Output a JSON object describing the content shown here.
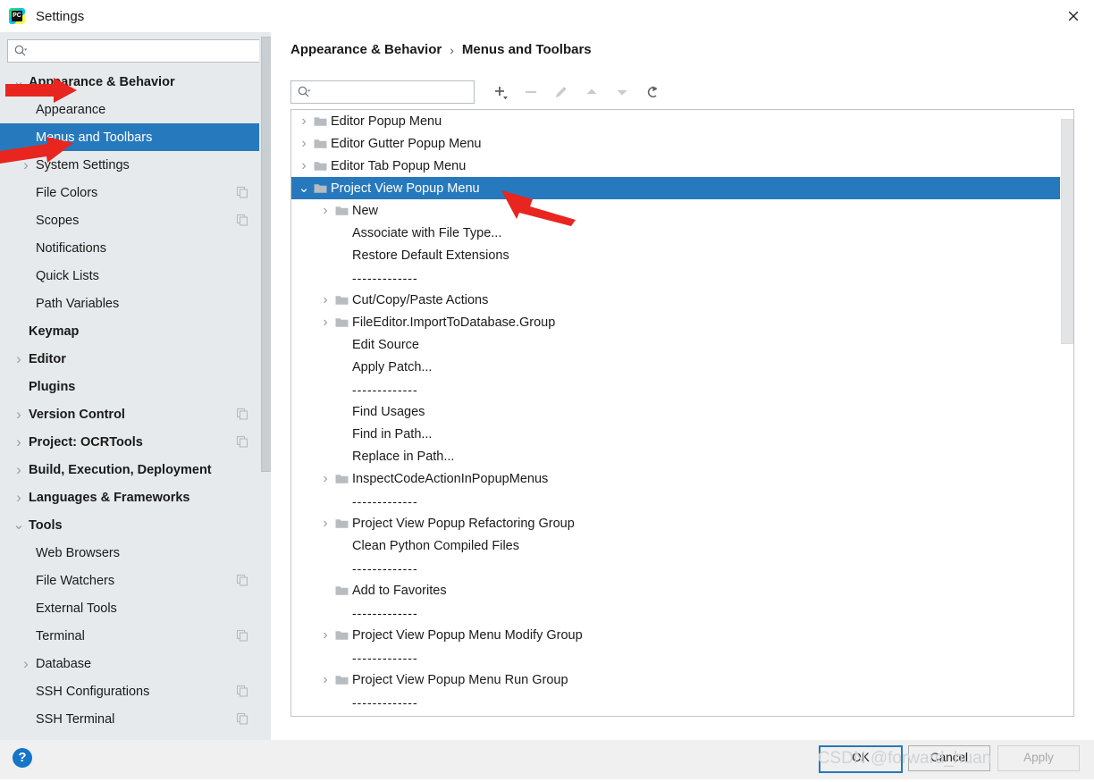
{
  "window": {
    "title": "Settings",
    "app_icon": "pycharm-icon",
    "close_icon": "close-icon"
  },
  "sidebar": {
    "search": {
      "placeholder": "",
      "value": "",
      "icon": "search-icon"
    },
    "items": [
      {
        "label": "Appearance & Behavior",
        "indent": 0,
        "bold": true,
        "arrow": "expanded",
        "badge": false,
        "selected": false
      },
      {
        "label": "Appearance",
        "indent": 1,
        "bold": false,
        "arrow": "none",
        "badge": false,
        "selected": false
      },
      {
        "label": "Menus and Toolbars",
        "indent": 1,
        "bold": false,
        "arrow": "none",
        "badge": false,
        "selected": true
      },
      {
        "label": "System Settings",
        "indent": 1,
        "bold": false,
        "arrow": "collapsed",
        "badge": false,
        "selected": false
      },
      {
        "label": "File Colors",
        "indent": 1,
        "bold": false,
        "arrow": "none",
        "badge": true,
        "selected": false
      },
      {
        "label": "Scopes",
        "indent": 1,
        "bold": false,
        "arrow": "none",
        "badge": true,
        "selected": false
      },
      {
        "label": "Notifications",
        "indent": 1,
        "bold": false,
        "arrow": "none",
        "badge": false,
        "selected": false
      },
      {
        "label": "Quick Lists",
        "indent": 1,
        "bold": false,
        "arrow": "none",
        "badge": false,
        "selected": false
      },
      {
        "label": "Path Variables",
        "indent": 1,
        "bold": false,
        "arrow": "none",
        "badge": false,
        "selected": false
      },
      {
        "label": "Keymap",
        "indent": 0,
        "bold": true,
        "arrow": "none",
        "badge": false,
        "selected": false
      },
      {
        "label": "Editor",
        "indent": 0,
        "bold": true,
        "arrow": "collapsed",
        "badge": false,
        "selected": false
      },
      {
        "label": "Plugins",
        "indent": 0,
        "bold": true,
        "arrow": "none",
        "badge": false,
        "selected": false
      },
      {
        "label": "Version Control",
        "indent": 0,
        "bold": true,
        "arrow": "collapsed",
        "badge": true,
        "selected": false
      },
      {
        "label": "Project: OCRTools",
        "indent": 0,
        "bold": true,
        "arrow": "collapsed",
        "badge": true,
        "selected": false
      },
      {
        "label": "Build, Execution, Deployment",
        "indent": 0,
        "bold": true,
        "arrow": "collapsed",
        "badge": false,
        "selected": false
      },
      {
        "label": "Languages & Frameworks",
        "indent": 0,
        "bold": true,
        "arrow": "collapsed",
        "badge": false,
        "selected": false
      },
      {
        "label": "Tools",
        "indent": 0,
        "bold": true,
        "arrow": "expanded",
        "badge": false,
        "selected": false
      },
      {
        "label": "Web Browsers",
        "indent": 1,
        "bold": false,
        "arrow": "none",
        "badge": false,
        "selected": false
      },
      {
        "label": "File Watchers",
        "indent": 1,
        "bold": false,
        "arrow": "none",
        "badge": true,
        "selected": false
      },
      {
        "label": "External Tools",
        "indent": 1,
        "bold": false,
        "arrow": "none",
        "badge": false,
        "selected": false
      },
      {
        "label": "Terminal",
        "indent": 1,
        "bold": false,
        "arrow": "none",
        "badge": true,
        "selected": false
      },
      {
        "label": "Database",
        "indent": 1,
        "bold": false,
        "arrow": "collapsed",
        "badge": false,
        "selected": false
      },
      {
        "label": "SSH Configurations",
        "indent": 1,
        "bold": false,
        "arrow": "none",
        "badge": true,
        "selected": false
      },
      {
        "label": "SSH Terminal",
        "indent": 1,
        "bold": false,
        "arrow": "none",
        "badge": true,
        "selected": false
      }
    ]
  },
  "main": {
    "breadcrumb": {
      "parent": "Appearance & Behavior",
      "separator": "›",
      "current": "Menus and Toolbars"
    },
    "search": {
      "placeholder": "",
      "value": "",
      "icon": "search-icon"
    },
    "toolbar": [
      {
        "name": "add-button",
        "icon": "plus-dropdown-icon",
        "enabled": true
      },
      {
        "name": "remove-button",
        "icon": "minus-icon",
        "enabled": false
      },
      {
        "name": "edit-button",
        "icon": "pencil-icon",
        "enabled": false
      },
      {
        "name": "move-up-button",
        "icon": "arrow-up-icon",
        "enabled": false
      },
      {
        "name": "move-down-button",
        "icon": "arrow-down-icon",
        "enabled": false
      },
      {
        "name": "restore-button",
        "icon": "revert-icon",
        "enabled": true
      }
    ],
    "tree": [
      {
        "label": "Editor Popup Menu",
        "indent": 0,
        "arrow": "collapsed",
        "folder": true,
        "selected": false,
        "separator": false
      },
      {
        "label": "Editor Gutter Popup Menu",
        "indent": 0,
        "arrow": "collapsed",
        "folder": true,
        "selected": false,
        "separator": false
      },
      {
        "label": "Editor Tab Popup Menu",
        "indent": 0,
        "arrow": "collapsed",
        "folder": true,
        "selected": false,
        "separator": false
      },
      {
        "label": "Project View Popup Menu",
        "indent": 0,
        "arrow": "expanded",
        "folder": true,
        "selected": true,
        "separator": false
      },
      {
        "label": "New",
        "indent": 1,
        "arrow": "collapsed",
        "folder": true,
        "selected": false,
        "separator": false
      },
      {
        "label": "Associate with File Type...",
        "indent": 1,
        "arrow": "none",
        "folder": false,
        "selected": false,
        "separator": false
      },
      {
        "label": "Restore Default Extensions",
        "indent": 1,
        "arrow": "none",
        "folder": false,
        "selected": false,
        "separator": false
      },
      {
        "label": "-------------",
        "indent": 1,
        "arrow": "none",
        "folder": false,
        "selected": false,
        "separator": true
      },
      {
        "label": "Cut/Copy/Paste Actions",
        "indent": 1,
        "arrow": "collapsed",
        "folder": true,
        "selected": false,
        "separator": false
      },
      {
        "label": "FileEditor.ImportToDatabase.Group",
        "indent": 1,
        "arrow": "collapsed",
        "folder": true,
        "selected": false,
        "separator": false
      },
      {
        "label": "Edit Source",
        "indent": 1,
        "arrow": "none",
        "folder": false,
        "selected": false,
        "separator": false
      },
      {
        "label": "Apply Patch...",
        "indent": 1,
        "arrow": "none",
        "folder": false,
        "selected": false,
        "separator": false
      },
      {
        "label": "-------------",
        "indent": 1,
        "arrow": "none",
        "folder": false,
        "selected": false,
        "separator": true
      },
      {
        "label": "Find Usages",
        "indent": 1,
        "arrow": "none",
        "folder": false,
        "selected": false,
        "separator": false
      },
      {
        "label": "Find in Path...",
        "indent": 1,
        "arrow": "none",
        "folder": false,
        "selected": false,
        "separator": false
      },
      {
        "label": "Replace in Path...",
        "indent": 1,
        "arrow": "none",
        "folder": false,
        "selected": false,
        "separator": false
      },
      {
        "label": "InspectCodeActionInPopupMenus",
        "indent": 1,
        "arrow": "collapsed",
        "folder": true,
        "selected": false,
        "separator": false
      },
      {
        "label": "-------------",
        "indent": 1,
        "arrow": "none",
        "folder": false,
        "selected": false,
        "separator": true
      },
      {
        "label": "Project View Popup Refactoring Group",
        "indent": 1,
        "arrow": "collapsed",
        "folder": true,
        "selected": false,
        "separator": false
      },
      {
        "label": "Clean Python Compiled Files",
        "indent": 1,
        "arrow": "none",
        "folder": false,
        "selected": false,
        "separator": false
      },
      {
        "label": "-------------",
        "indent": 1,
        "arrow": "none",
        "folder": false,
        "selected": false,
        "separator": true
      },
      {
        "label": "Add to Favorites",
        "indent": 1,
        "arrow": "none",
        "folder": true,
        "selected": false,
        "separator": false
      },
      {
        "label": "-------------",
        "indent": 1,
        "arrow": "none",
        "folder": false,
        "selected": false,
        "separator": true
      },
      {
        "label": "Project View Popup Menu Modify Group",
        "indent": 1,
        "arrow": "collapsed",
        "folder": true,
        "selected": false,
        "separator": false
      },
      {
        "label": "-------------",
        "indent": 1,
        "arrow": "none",
        "folder": false,
        "selected": false,
        "separator": true
      },
      {
        "label": "Project View Popup Menu Run Group",
        "indent": 1,
        "arrow": "collapsed",
        "folder": true,
        "selected": false,
        "separator": false
      },
      {
        "label": "-------------",
        "indent": 1,
        "arrow": "none",
        "folder": false,
        "selected": false,
        "separator": true
      }
    ]
  },
  "footer": {
    "help_label": "?",
    "ok_label": "OK",
    "cancel_label": "Cancel",
    "apply_label": "Apply"
  },
  "overlay": {
    "watermark": "CSDN @forward_huan",
    "annotations": [
      "arrow-appearance-behavior",
      "arrow-menus-and-toolbars",
      "arrow-project-view-popup-menu"
    ]
  },
  "colors": {
    "selection": "#2779bd",
    "sidebar_bg": "#e6eaed",
    "panel_bg": "#ffffff",
    "footer_bg": "#f0f0f0",
    "annotation": "#e8251f"
  }
}
